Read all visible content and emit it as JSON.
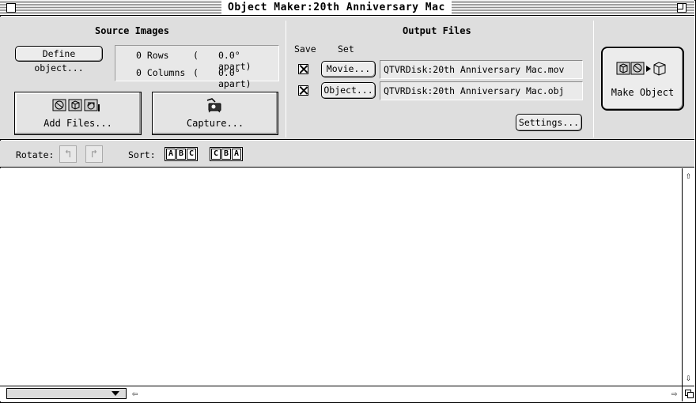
{
  "window": {
    "title": "Object Maker:20th Anniversary Mac"
  },
  "source": {
    "heading": "Source Images",
    "define_button": "Define object...",
    "rows_label": "0 Rows",
    "rows_paren": "(",
    "rows_apart": "0.0° apart)",
    "columns_label": "0 Columns",
    "columns_paren": "(",
    "columns_apart": "0.0° apart)",
    "add_files_label": "Add Files...",
    "capture_label": "Capture..."
  },
  "output": {
    "heading": "Output Files",
    "save_label": "Save",
    "set_label": "Set",
    "movie_button": "Movie...",
    "movie_path": "QTVRDisk:20th Anniversary Mac.mov",
    "object_button": "Object...",
    "object_path": "QTVRDisk:20th Anniversary Mac.obj",
    "settings_button": "Settings...",
    "make_object_label": "Make Object"
  },
  "toolbar": {
    "rotate_label": "Rotate:",
    "sort_label": "Sort:",
    "sort_abc": [
      "A",
      "B",
      "C"
    ],
    "sort_cba": [
      "C",
      "B",
      "A"
    ]
  }
}
